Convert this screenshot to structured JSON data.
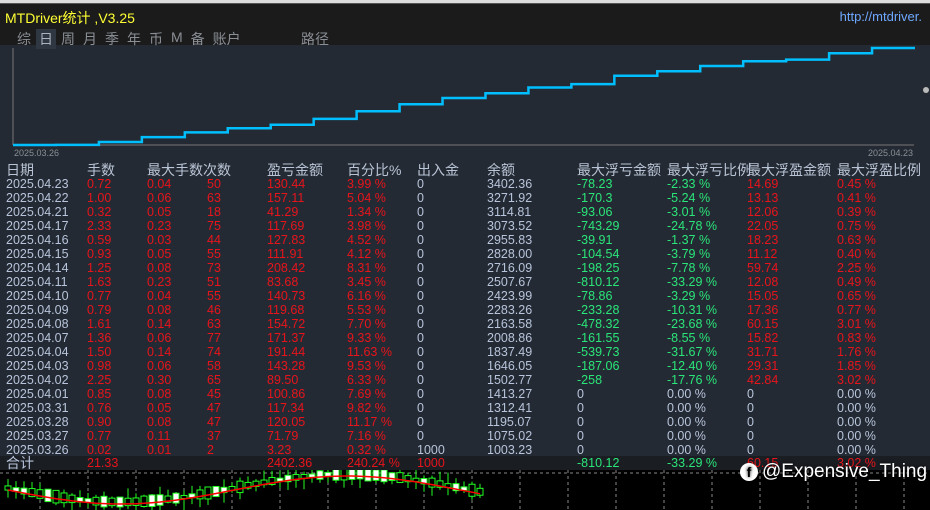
{
  "app": {
    "title": "MTDriver统计 ,V3.25",
    "url": "http://mtdriver."
  },
  "tabs": [
    {
      "label": "综"
    },
    {
      "label": "日",
      "active": true
    },
    {
      "label": "周"
    },
    {
      "label": "月"
    },
    {
      "label": "季"
    },
    {
      "label": "年"
    },
    {
      "label": "币"
    },
    {
      "label": "M"
    },
    {
      "label": "备"
    },
    {
      "label": "账户"
    }
  ],
  "path_tab": "路径",
  "equity_chart": {
    "start_label": "2025.03.26",
    "end_label": "2025.04.23",
    "color": "#00bfff"
  },
  "columns": [
    "日期",
    "手数",
    "最大手数",
    "次数",
    "盈亏金额",
    "百分比%",
    "出入金",
    "余额",
    "最大浮亏金额",
    "最大浮亏比例",
    "最大浮盈金额",
    "最大浮盈比例"
  ],
  "rows": [
    [
      "2025.04.23",
      "0.72",
      "0.04",
      "50",
      "130.44",
      "3.99 %",
      "0",
      "3402.36",
      "-78.23",
      "-2.33 %",
      "14.69",
      "0.45 %"
    ],
    [
      "2025.04.22",
      "1.00",
      "0.06",
      "63",
      "157.11",
      "5.04 %",
      "0",
      "3271.92",
      "-170.3",
      "-5.24 %",
      "13.13",
      "0.41 %"
    ],
    [
      "2025.04.21",
      "0.32",
      "0.05",
      "18",
      "41.29",
      "1.34 %",
      "0",
      "3114.81",
      "-93.06",
      "-3.01 %",
      "12.06",
      "0.39 %"
    ],
    [
      "2025.04.17",
      "2.33",
      "0.23",
      "75",
      "117.69",
      "3.98 %",
      "0",
      "3073.52",
      "-743.29",
      "-24.78 %",
      "22.05",
      "0.75 %"
    ],
    [
      "2025.04.16",
      "0.59",
      "0.03",
      "44",
      "127.83",
      "4.52 %",
      "0",
      "2955.83",
      "-39.91",
      "-1.37 %",
      "18.23",
      "0.63 %"
    ],
    [
      "2025.04.15",
      "0.93",
      "0.05",
      "55",
      "111.91",
      "4.12 %",
      "0",
      "2828.00",
      "-104.54",
      "-3.79 %",
      "11.12",
      "0.40 %"
    ],
    [
      "2025.04.14",
      "1.25",
      "0.08",
      "73",
      "208.42",
      "8.31 %",
      "0",
      "2716.09",
      "-198.25",
      "-7.78 %",
      "59.74",
      "2.25 %"
    ],
    [
      "2025.04.11",
      "1.63",
      "0.23",
      "51",
      "83.68",
      "3.45 %",
      "0",
      "2507.67",
      "-810.12",
      "-33.29 %",
      "12.08",
      "0.49 %"
    ],
    [
      "2025.04.10",
      "0.77",
      "0.04",
      "55",
      "140.73",
      "6.16 %",
      "0",
      "2423.99",
      "-78.86",
      "-3.29 %",
      "15.05",
      "0.65 %"
    ],
    [
      "2025.04.09",
      "0.79",
      "0.08",
      "46",
      "119.68",
      "5.53 %",
      "0",
      "2283.26",
      "-233.28",
      "-10.31 %",
      "17.36",
      "0.77 %"
    ],
    [
      "2025.04.08",
      "1.61",
      "0.14",
      "63",
      "154.72",
      "7.70 %",
      "0",
      "2163.58",
      "-478.32",
      "-23.68 %",
      "60.15",
      "3.01 %"
    ],
    [
      "2025.04.07",
      "1.36",
      "0.06",
      "77",
      "171.37",
      "9.33 %",
      "0",
      "2008.86",
      "-161.55",
      "-8.55 %",
      "15.82",
      "0.83 %"
    ],
    [
      "2025.04.04",
      "1.50",
      "0.14",
      "74",
      "191.44",
      "11.63 %",
      "0",
      "1837.49",
      "-539.73",
      "-31.67 %",
      "31.71",
      "1.76 %"
    ],
    [
      "2025.04.03",
      "0.98",
      "0.06",
      "58",
      "143.28",
      "9.53 %",
      "0",
      "1646.05",
      "-187.06",
      "-12.40 %",
      "29.31",
      "1.85 %"
    ],
    [
      "2025.04.02",
      "2.25",
      "0.30",
      "65",
      "89.50",
      "6.33 %",
      "0",
      "1502.77",
      "-258",
      "-17.76 %",
      "42.84",
      "3.02 %"
    ],
    [
      "2025.04.01",
      "0.85",
      "0.08",
      "45",
      "100.86",
      "7.69 %",
      "0",
      "1413.27",
      "0",
      "0.00 %",
      "0",
      "0.00 %"
    ],
    [
      "2025.03.31",
      "0.76",
      "0.05",
      "47",
      "117.34",
      "9.82 %",
      "0",
      "1312.41",
      "0",
      "0.00 %",
      "0",
      "0.00 %"
    ],
    [
      "2025.03.28",
      "0.90",
      "0.08",
      "47",
      "120.05",
      "11.17 %",
      "0",
      "1195.07",
      "0",
      "0.00 %",
      "0",
      "0.00 %"
    ],
    [
      "2025.03.27",
      "0.77",
      "0.11",
      "37",
      "71.79",
      "7.16 %",
      "0",
      "1075.02",
      "0",
      "0.00 %",
      "0",
      "0.00 %"
    ],
    [
      "2025.03.26",
      "0.02",
      "0.01",
      "2",
      "3.23",
      "0.32 %",
      "1000",
      "1003.23",
      "0",
      "0.00 %",
      "0",
      "0.00 %"
    ]
  ],
  "totals": {
    "label": "合计",
    "lots": "21.33",
    "pnl": "2402.36",
    "pct": "240.24 %",
    "deposit": "1000",
    "max_dd": "-810.12",
    "max_dd_pct": "-33.29 %",
    "max_fp": "60.15",
    "max_fp_pct": "3.02 %"
  },
  "watermark": "@Expensive_Thing",
  "colors": {
    "red": "#e8141c",
    "green": "#2ae67a",
    "gray": "#b7c4db",
    "title": "#ffff33"
  }
}
